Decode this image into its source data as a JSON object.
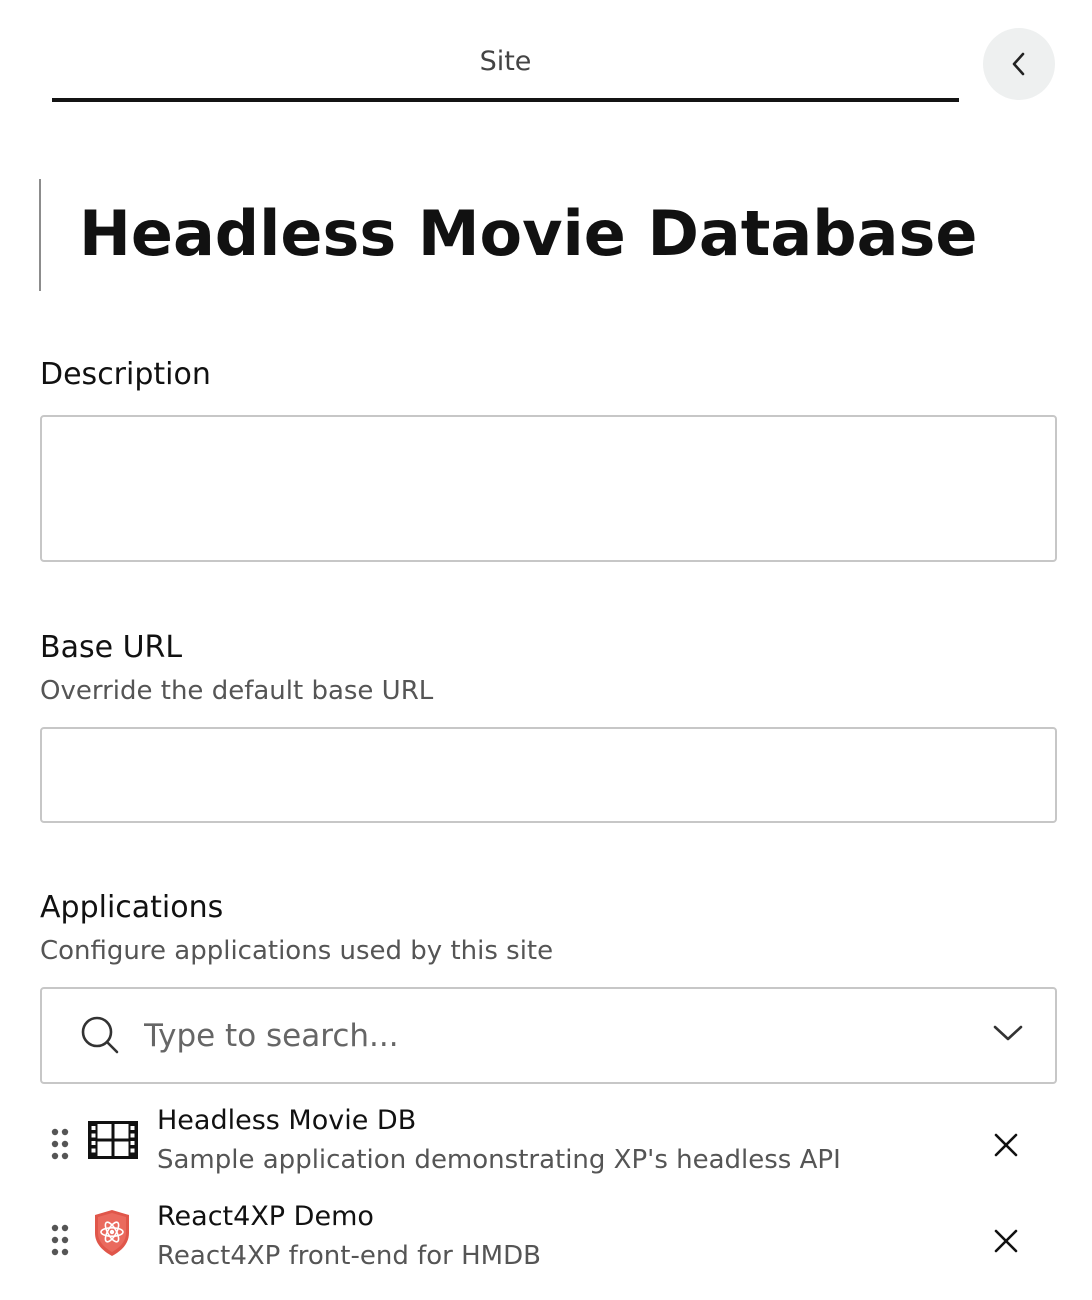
{
  "tab": {
    "label": "Site"
  },
  "header": {
    "back_icon": "chevron-left-icon"
  },
  "page_title": "Headless Movie Database",
  "description": {
    "label": "Description",
    "value": ""
  },
  "base_url": {
    "label": "Base URL",
    "help": "Override the default base URL",
    "value": ""
  },
  "applications": {
    "label": "Applications",
    "help": "Configure applications used by this site",
    "search": {
      "placeholder": "Type to search...",
      "value": ""
    },
    "items": [
      {
        "name": "Headless Movie DB",
        "description": "Sample application demonstrating XP's headless API",
        "icon": "film-strip-icon"
      },
      {
        "name": "React4XP Demo",
        "description": "React4XP front-end for HMDB",
        "icon": "react-shield-icon"
      }
    ]
  },
  "colors": {
    "accent": "#141414",
    "border": "#c7c7c7",
    "back_button_bg": "#eef0f0",
    "react_icon": "#e0564a"
  }
}
